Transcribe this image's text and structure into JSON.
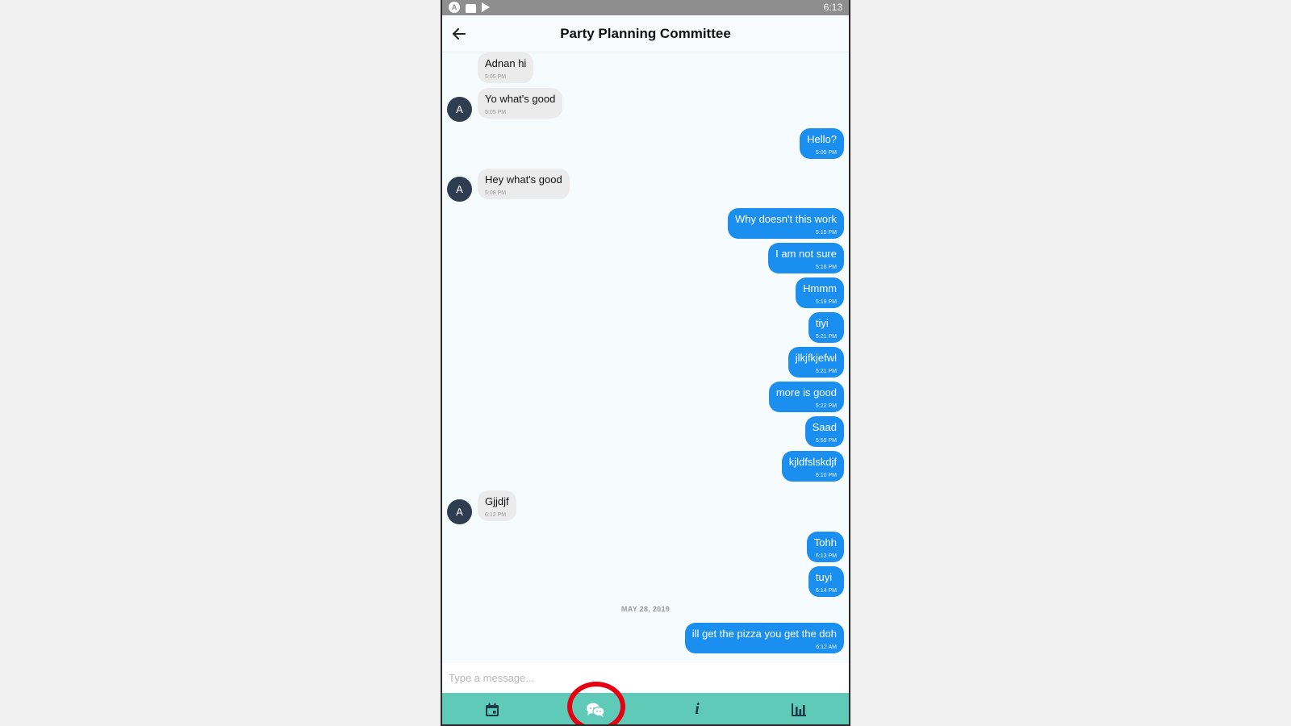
{
  "status_bar": {
    "time": "6:13",
    "icons": [
      "app-a-icon",
      "folder-icon",
      "play-store-icon"
    ]
  },
  "header": {
    "title": "Party Planning Committee",
    "back_icon": "back-arrow-icon"
  },
  "avatar_initial": "A",
  "messages": [
    {
      "dir": "in",
      "text": "Adnan hi",
      "time": "5:05 PM",
      "avatar": false
    },
    {
      "dir": "in",
      "text": "Yo what's good",
      "time": "5:05 PM",
      "avatar": true
    },
    {
      "dir": "out",
      "text": "Hello?",
      "time": "5:05 PM"
    },
    {
      "dir": "in",
      "text": "Hey what's good",
      "time": "5:08 PM",
      "avatar": true
    },
    {
      "dir": "out",
      "text": "Why doesn't this work",
      "time": "5:15 PM"
    },
    {
      "dir": "out",
      "text": "I am not sure",
      "time": "5:16 PM"
    },
    {
      "dir": "out",
      "text": "Hmmm",
      "time": "5:19 PM"
    },
    {
      "dir": "out",
      "text": "tiyi",
      "time": "5:21 PM"
    },
    {
      "dir": "out",
      "text": "jlkjfkjefwl",
      "time": "5:21 PM"
    },
    {
      "dir": "out",
      "text": "more is good",
      "time": "5:22 PM"
    },
    {
      "dir": "out",
      "text": "Saad",
      "time": "5:59 PM"
    },
    {
      "dir": "out",
      "text": "kjldfslskdjf",
      "time": "6:10 PM"
    },
    {
      "dir": "in",
      "text": "Gjjdjf",
      "time": "6:12 PM",
      "avatar": true
    },
    {
      "dir": "out",
      "text": "Tohh",
      "time": "6:13 PM"
    },
    {
      "dir": "out",
      "text": "tuyi",
      "time": "6:14 PM"
    },
    {
      "dir": "out",
      "text": "ill get the pizza you get the doh",
      "time": "6:12 AM"
    }
  ],
  "date_separator": "MAY 28, 2019",
  "composer": {
    "placeholder": "Type a message..."
  },
  "tabs": [
    {
      "name": "calendar",
      "icon": "calendar-icon"
    },
    {
      "name": "chat",
      "icon": "chat-bubbles-icon",
      "active": true
    },
    {
      "name": "info",
      "icon": "info-icon",
      "glyph": "i"
    },
    {
      "name": "stats",
      "icon": "bar-chart-icon"
    }
  ],
  "colors": {
    "outgoing_bubble": "#1b8ff0",
    "incoming_bubble": "#ebebeb",
    "tab_bar": "#5fcab8",
    "avatar": "#2e3d4f",
    "highlight_ring": "#e60012"
  }
}
